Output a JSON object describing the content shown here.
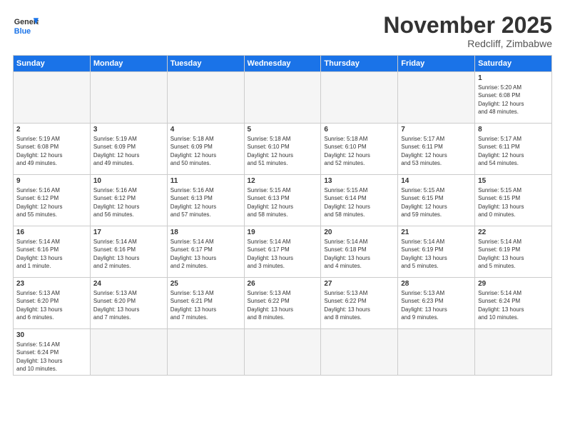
{
  "header": {
    "logo_general": "General",
    "logo_blue": "Blue",
    "month_title": "November 2025",
    "subtitle": "Redcliff, Zimbabwe"
  },
  "days_of_week": [
    "Sunday",
    "Monday",
    "Tuesday",
    "Wednesday",
    "Thursday",
    "Friday",
    "Saturday"
  ],
  "weeks": [
    [
      {
        "day": "",
        "info": "",
        "empty": true
      },
      {
        "day": "",
        "info": "",
        "empty": true
      },
      {
        "day": "",
        "info": "",
        "empty": true
      },
      {
        "day": "",
        "info": "",
        "empty": true
      },
      {
        "day": "",
        "info": "",
        "empty": true
      },
      {
        "day": "",
        "info": "",
        "empty": true
      },
      {
        "day": "1",
        "info": "Sunrise: 5:20 AM\nSunset: 6:08 PM\nDaylight: 12 hours\nand 48 minutes."
      }
    ],
    [
      {
        "day": "2",
        "info": "Sunrise: 5:19 AM\nSunset: 6:08 PM\nDaylight: 12 hours\nand 49 minutes."
      },
      {
        "day": "3",
        "info": "Sunrise: 5:19 AM\nSunset: 6:09 PM\nDaylight: 12 hours\nand 49 minutes."
      },
      {
        "day": "4",
        "info": "Sunrise: 5:18 AM\nSunset: 6:09 PM\nDaylight: 12 hours\nand 50 minutes."
      },
      {
        "day": "5",
        "info": "Sunrise: 5:18 AM\nSunset: 6:10 PM\nDaylight: 12 hours\nand 51 minutes."
      },
      {
        "day": "6",
        "info": "Sunrise: 5:18 AM\nSunset: 6:10 PM\nDaylight: 12 hours\nand 52 minutes."
      },
      {
        "day": "7",
        "info": "Sunrise: 5:17 AM\nSunset: 6:11 PM\nDaylight: 12 hours\nand 53 minutes."
      },
      {
        "day": "8",
        "info": "Sunrise: 5:17 AM\nSunset: 6:11 PM\nDaylight: 12 hours\nand 54 minutes."
      }
    ],
    [
      {
        "day": "9",
        "info": "Sunrise: 5:16 AM\nSunset: 6:12 PM\nDaylight: 12 hours\nand 55 minutes."
      },
      {
        "day": "10",
        "info": "Sunrise: 5:16 AM\nSunset: 6:12 PM\nDaylight: 12 hours\nand 56 minutes."
      },
      {
        "day": "11",
        "info": "Sunrise: 5:16 AM\nSunset: 6:13 PM\nDaylight: 12 hours\nand 57 minutes."
      },
      {
        "day": "12",
        "info": "Sunrise: 5:15 AM\nSunset: 6:13 PM\nDaylight: 12 hours\nand 58 minutes."
      },
      {
        "day": "13",
        "info": "Sunrise: 5:15 AM\nSunset: 6:14 PM\nDaylight: 12 hours\nand 58 minutes."
      },
      {
        "day": "14",
        "info": "Sunrise: 5:15 AM\nSunset: 6:15 PM\nDaylight: 12 hours\nand 59 minutes."
      },
      {
        "day": "15",
        "info": "Sunrise: 5:15 AM\nSunset: 6:15 PM\nDaylight: 13 hours\nand 0 minutes."
      }
    ],
    [
      {
        "day": "16",
        "info": "Sunrise: 5:14 AM\nSunset: 6:16 PM\nDaylight: 13 hours\nand 1 minute."
      },
      {
        "day": "17",
        "info": "Sunrise: 5:14 AM\nSunset: 6:16 PM\nDaylight: 13 hours\nand 2 minutes."
      },
      {
        "day": "18",
        "info": "Sunrise: 5:14 AM\nSunset: 6:17 PM\nDaylight: 13 hours\nand 2 minutes."
      },
      {
        "day": "19",
        "info": "Sunrise: 5:14 AM\nSunset: 6:17 PM\nDaylight: 13 hours\nand 3 minutes."
      },
      {
        "day": "20",
        "info": "Sunrise: 5:14 AM\nSunset: 6:18 PM\nDaylight: 13 hours\nand 4 minutes."
      },
      {
        "day": "21",
        "info": "Sunrise: 5:14 AM\nSunset: 6:19 PM\nDaylight: 13 hours\nand 5 minutes."
      },
      {
        "day": "22",
        "info": "Sunrise: 5:14 AM\nSunset: 6:19 PM\nDaylight: 13 hours\nand 5 minutes."
      }
    ],
    [
      {
        "day": "23",
        "info": "Sunrise: 5:13 AM\nSunset: 6:20 PM\nDaylight: 13 hours\nand 6 minutes."
      },
      {
        "day": "24",
        "info": "Sunrise: 5:13 AM\nSunset: 6:20 PM\nDaylight: 13 hours\nand 7 minutes."
      },
      {
        "day": "25",
        "info": "Sunrise: 5:13 AM\nSunset: 6:21 PM\nDaylight: 13 hours\nand 7 minutes."
      },
      {
        "day": "26",
        "info": "Sunrise: 5:13 AM\nSunset: 6:22 PM\nDaylight: 13 hours\nand 8 minutes."
      },
      {
        "day": "27",
        "info": "Sunrise: 5:13 AM\nSunset: 6:22 PM\nDaylight: 13 hours\nand 8 minutes."
      },
      {
        "day": "28",
        "info": "Sunrise: 5:13 AM\nSunset: 6:23 PM\nDaylight: 13 hours\nand 9 minutes."
      },
      {
        "day": "29",
        "info": "Sunrise: 5:14 AM\nSunset: 6:24 PM\nDaylight: 13 hours\nand 10 minutes."
      }
    ],
    [
      {
        "day": "30",
        "info": "Sunrise: 5:14 AM\nSunset: 6:24 PM\nDaylight: 13 hours\nand 10 minutes.",
        "last": true
      },
      {
        "day": "",
        "info": "",
        "empty": true,
        "last": true
      },
      {
        "day": "",
        "info": "",
        "empty": true,
        "last": true
      },
      {
        "day": "",
        "info": "",
        "empty": true,
        "last": true
      },
      {
        "day": "",
        "info": "",
        "empty": true,
        "last": true
      },
      {
        "day": "",
        "info": "",
        "empty": true,
        "last": true
      },
      {
        "day": "",
        "info": "",
        "empty": true,
        "last": true
      }
    ]
  ]
}
